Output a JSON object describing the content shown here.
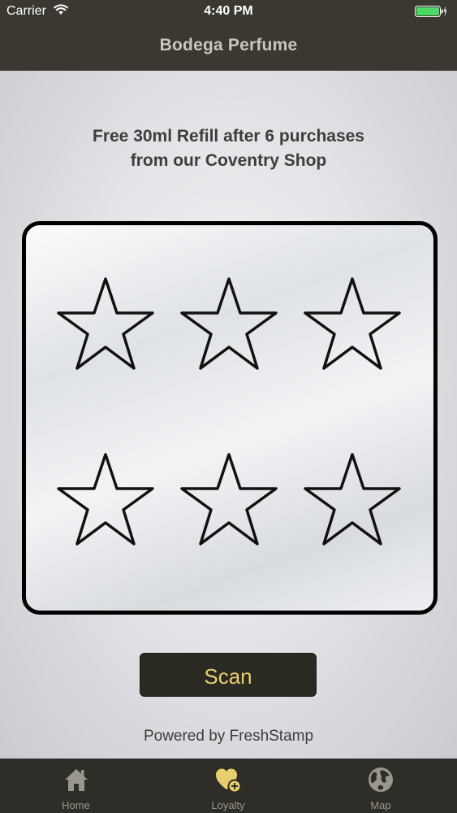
{
  "status_bar": {
    "carrier": "Carrier",
    "time": "4:40 PM",
    "battery_color": "#4cd964"
  },
  "nav": {
    "title": "Bodega Perfume"
  },
  "promo": {
    "line1": "Free 30ml Refill after 6 purchases",
    "line2": "from our Coventry Shop"
  },
  "stamp_card": {
    "total_stamps": 6,
    "stamps_collected": 0,
    "stamp_icon": "star-outline-icon"
  },
  "scan_button": {
    "label": "Scan",
    "text_color": "#e8cf6e"
  },
  "footer": {
    "powered_by": "Powered by FreshStamp"
  },
  "tab_bar": {
    "tabs": [
      {
        "label": "Home",
        "icon": "home-icon"
      },
      {
        "label": "Loyalty",
        "icon": "heart-plus-icon",
        "active": true,
        "accent": "#e8cf6e"
      },
      {
        "label": "Map",
        "icon": "globe-icon"
      }
    ]
  }
}
